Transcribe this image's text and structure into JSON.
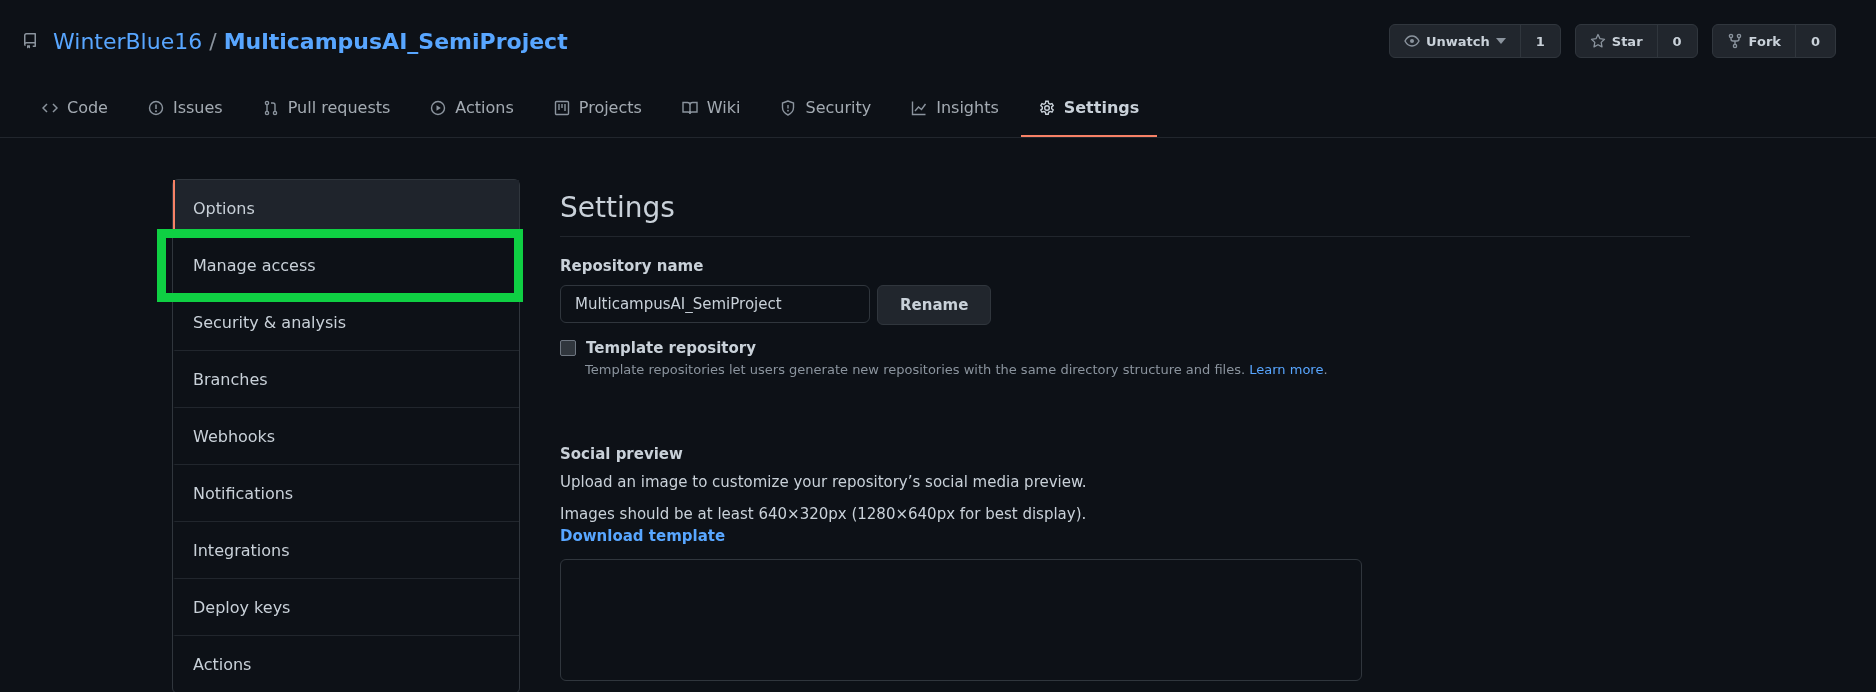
{
  "repo": {
    "owner": "WinterBlue16",
    "separator": "/",
    "name": "MulticampusAI_SemiProject"
  },
  "actions": [
    {
      "kind": "watch",
      "label": "Unwatch",
      "count": "1"
    },
    {
      "kind": "star",
      "label": "Star",
      "count": "0"
    },
    {
      "kind": "fork",
      "label": "Fork",
      "count": "0"
    }
  ],
  "tabs": [
    {
      "kind": "code",
      "label": "Code",
      "selected": false
    },
    {
      "kind": "issues",
      "label": "Issues",
      "selected": false
    },
    {
      "kind": "pulls",
      "label": "Pull requests",
      "selected": false
    },
    {
      "kind": "actions",
      "label": "Actions",
      "selected": false
    },
    {
      "kind": "projects",
      "label": "Projects",
      "selected": false
    },
    {
      "kind": "wiki",
      "label": "Wiki",
      "selected": false
    },
    {
      "kind": "security",
      "label": "Security",
      "selected": false
    },
    {
      "kind": "insights",
      "label": "Insights",
      "selected": false
    },
    {
      "kind": "settings",
      "label": "Settings",
      "selected": true
    }
  ],
  "sidebar": {
    "items": [
      {
        "label": "Options",
        "selected": true,
        "highlighted": false
      },
      {
        "label": "Manage access",
        "selected": false,
        "highlighted": true
      },
      {
        "label": "Security & analysis",
        "selected": false,
        "highlighted": false
      },
      {
        "label": "Branches",
        "selected": false,
        "highlighted": false
      },
      {
        "label": "Webhooks",
        "selected": false,
        "highlighted": false
      },
      {
        "label": "Notifications",
        "selected": false,
        "highlighted": false
      },
      {
        "label": "Integrations",
        "selected": false,
        "highlighted": false
      },
      {
        "label": "Deploy keys",
        "selected": false,
        "highlighted": false
      },
      {
        "label": "Actions",
        "selected": false,
        "highlighted": false
      }
    ]
  },
  "settings": {
    "title": "Settings",
    "repository_name": {
      "label": "Repository name",
      "value": "MulticampusAI_SemiProject",
      "button": "Rename"
    },
    "template": {
      "label": "Template repository",
      "checked": false,
      "description": "Template repositories let users generate new repositories with the same directory structure and files.",
      "link": "Learn more",
      "after_link": "."
    },
    "social_preview": {
      "title": "Social preview",
      "text": "Upload an image to customize your repository’s social media preview.",
      "size_note": "Images should be at least 640×320px (1280×640px for best display).",
      "link": "Download template"
    }
  }
}
